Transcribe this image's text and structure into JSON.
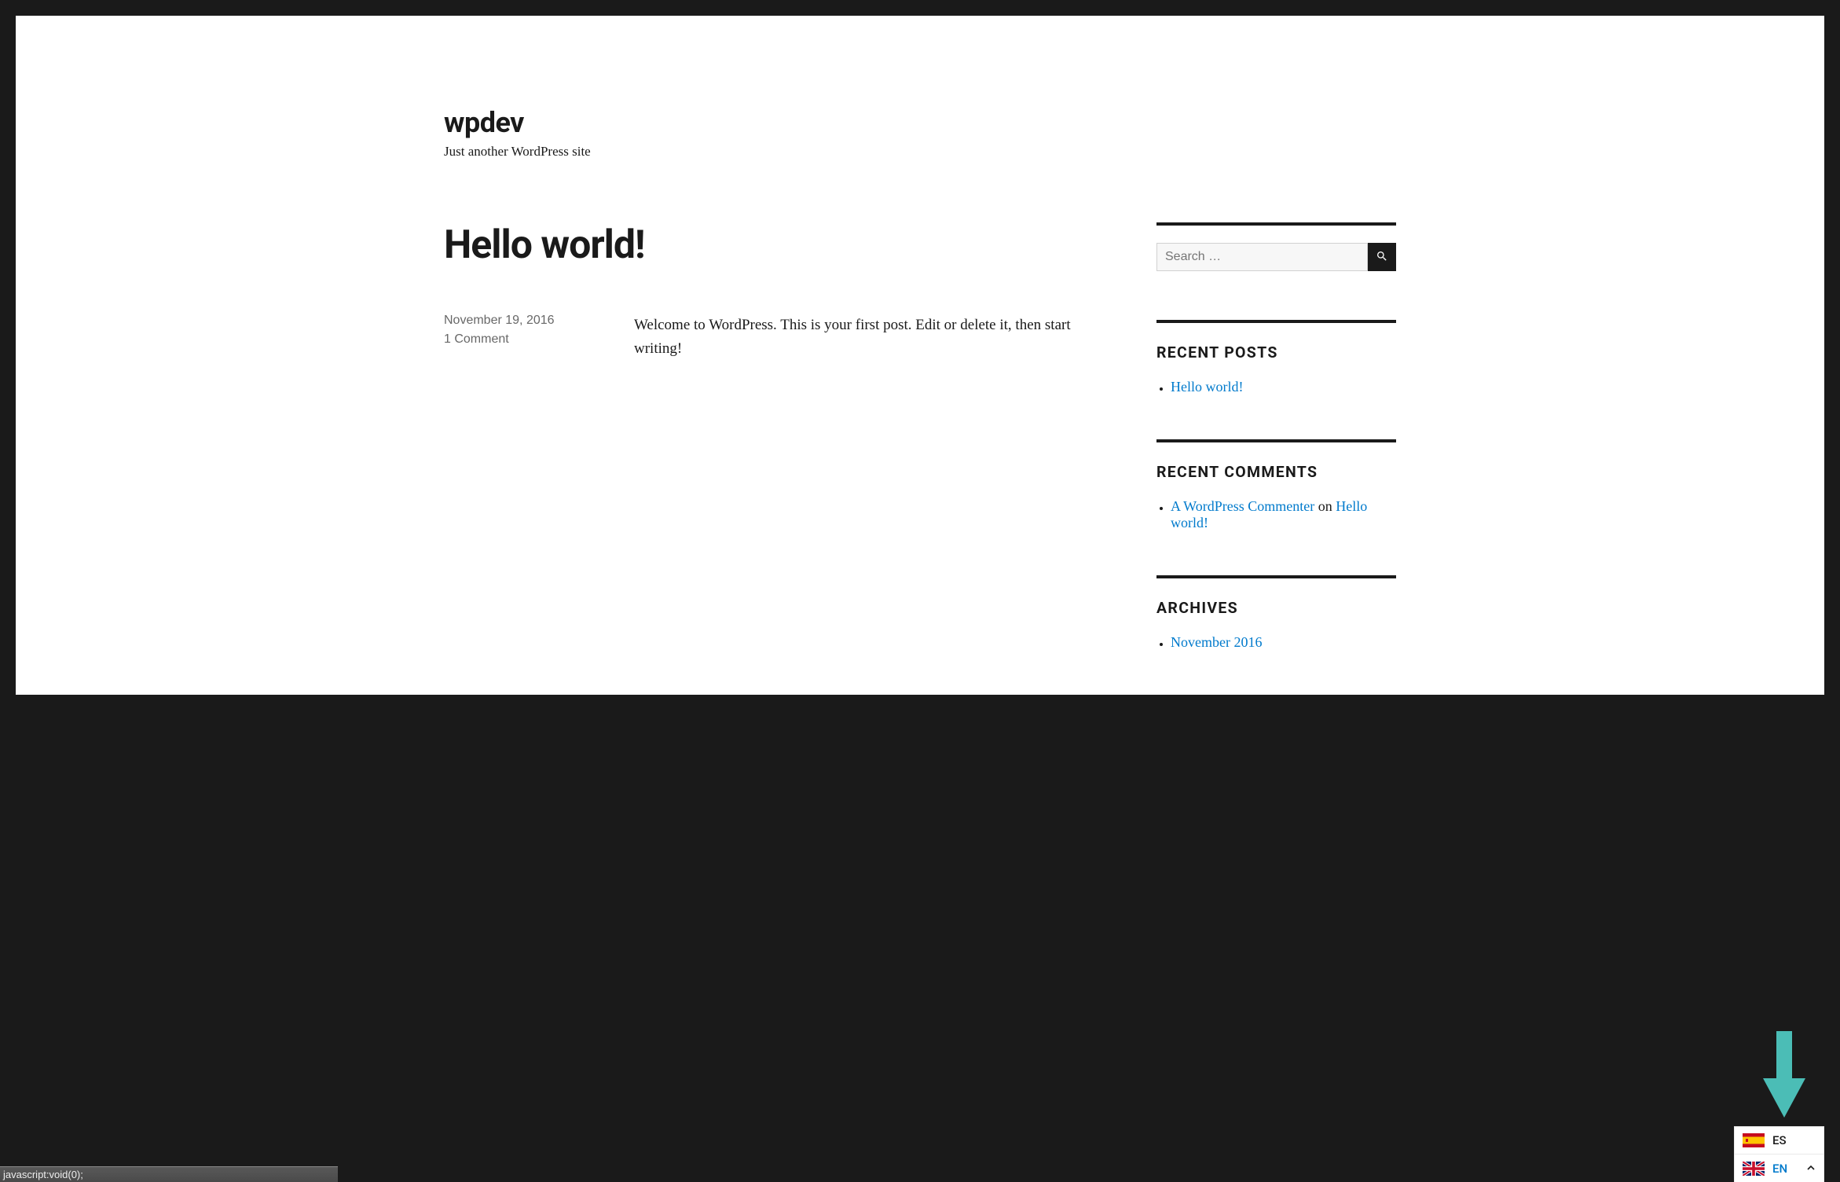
{
  "site": {
    "title": "wpdev",
    "tagline": "Just another WordPress site"
  },
  "post": {
    "title": "Hello world!",
    "date": "November 19, 2016",
    "comments": "1 Comment",
    "content": "Welcome to WordPress. This is your first post. Edit or delete it, then start writing!"
  },
  "sidebar": {
    "search_placeholder": "Search …",
    "recent_posts_heading": "RECENT POSTS",
    "recent_posts": [
      "Hello world!"
    ],
    "recent_comments_heading": "RECENT COMMENTS",
    "recent_comments": [
      {
        "author": "A WordPress Commenter",
        "on": " on ",
        "post": "Hello world!"
      }
    ],
    "archives_heading": "ARCHIVES",
    "archives": [
      "November 2016"
    ]
  },
  "lang": {
    "options": [
      {
        "code": "ES",
        "flag": "es"
      }
    ],
    "current": {
      "code": "EN",
      "flag": "gb"
    }
  },
  "statusbar": "javascript:void(0);"
}
